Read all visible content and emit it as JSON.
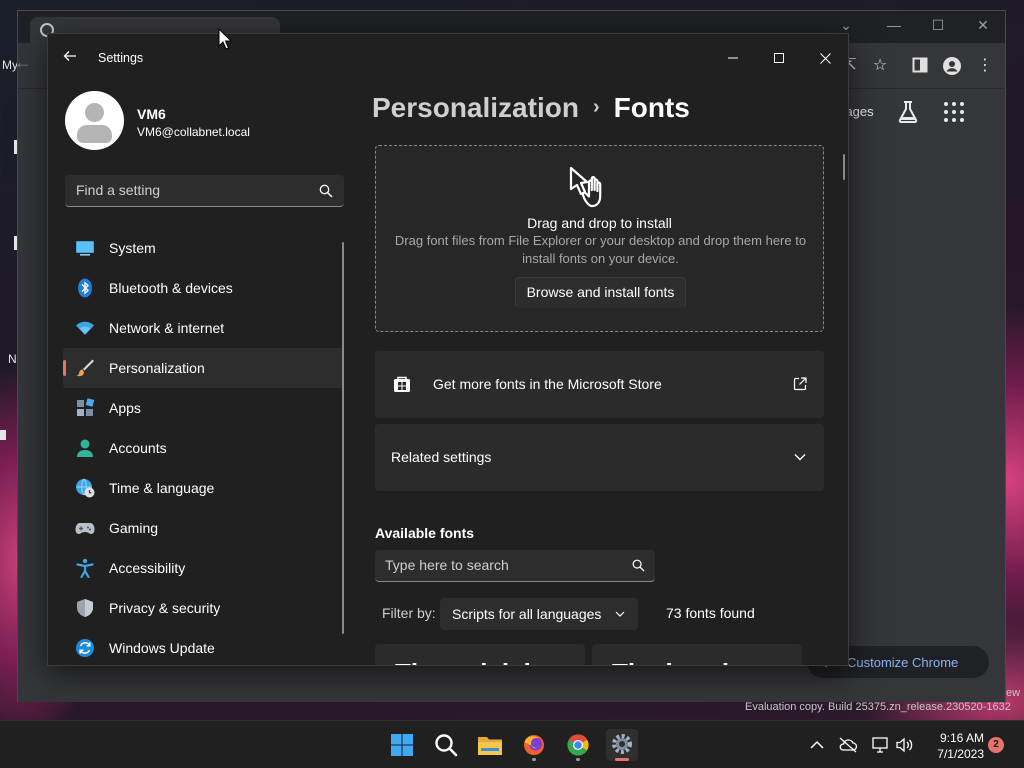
{
  "desktop": {
    "label_my": "My",
    "label_n": "N",
    "eval_text": "Evaluation copy. Build 25375.zn_release.230520-1632",
    "eval_tail": "ew"
  },
  "chrome": {
    "images_link": "Images",
    "customize_label": "Customize Chrome"
  },
  "settings": {
    "title": "Settings",
    "user": {
      "name": "VM6",
      "email": "VM6@collabnet.local"
    },
    "search_placeholder": "Find a setting",
    "nav": [
      {
        "label": "System",
        "icon": "system-icon"
      },
      {
        "label": "Bluetooth & devices",
        "icon": "bluetooth-icon"
      },
      {
        "label": "Network & internet",
        "icon": "wifi-icon"
      },
      {
        "label": "Personalization",
        "icon": "brush-icon",
        "active": true
      },
      {
        "label": "Apps",
        "icon": "apps-icon"
      },
      {
        "label": "Accounts",
        "icon": "accounts-icon"
      },
      {
        "label": "Time & language",
        "icon": "time-language-icon"
      },
      {
        "label": "Gaming",
        "icon": "gamepad-icon"
      },
      {
        "label": "Accessibility",
        "icon": "accessibility-icon"
      },
      {
        "label": "Privacy & security",
        "icon": "shield-icon"
      },
      {
        "label": "Windows Update",
        "icon": "windows-update-icon"
      }
    ],
    "breadcrumb": {
      "parent": "Personalization",
      "separator": "›",
      "current": "Fonts"
    },
    "dropzone": {
      "title": "Drag and drop to install",
      "description": "Drag font files from File Explorer or your desktop and drop them here to install fonts on your device.",
      "button": "Browse and install fonts"
    },
    "store_card": {
      "label": "Get more fonts in the Microsoft Store"
    },
    "related_card": {
      "label": "Related settings"
    },
    "available": {
      "title": "Available fonts",
      "search_placeholder": "Type here to search",
      "filter_label": "Filter by:",
      "filter_value": "Scripts for all languages",
      "found": "73 fonts found",
      "tiles": [
        "The quick brown fox",
        "The lazy brown dog"
      ]
    }
  },
  "taskbar": {
    "time": "9:16 AM",
    "date": "7/1/2023",
    "notification_count": "2",
    "apps": [
      "start-icon",
      "search-icon",
      "file-explorer-icon",
      "firefox-icon",
      "chrome-icon",
      "settings-icon"
    ]
  },
  "colors": {
    "accent": "#e8736a",
    "window_bg": "#202020",
    "card_bg": "#2b2b2b",
    "link_blue": "#8ab4f8"
  }
}
